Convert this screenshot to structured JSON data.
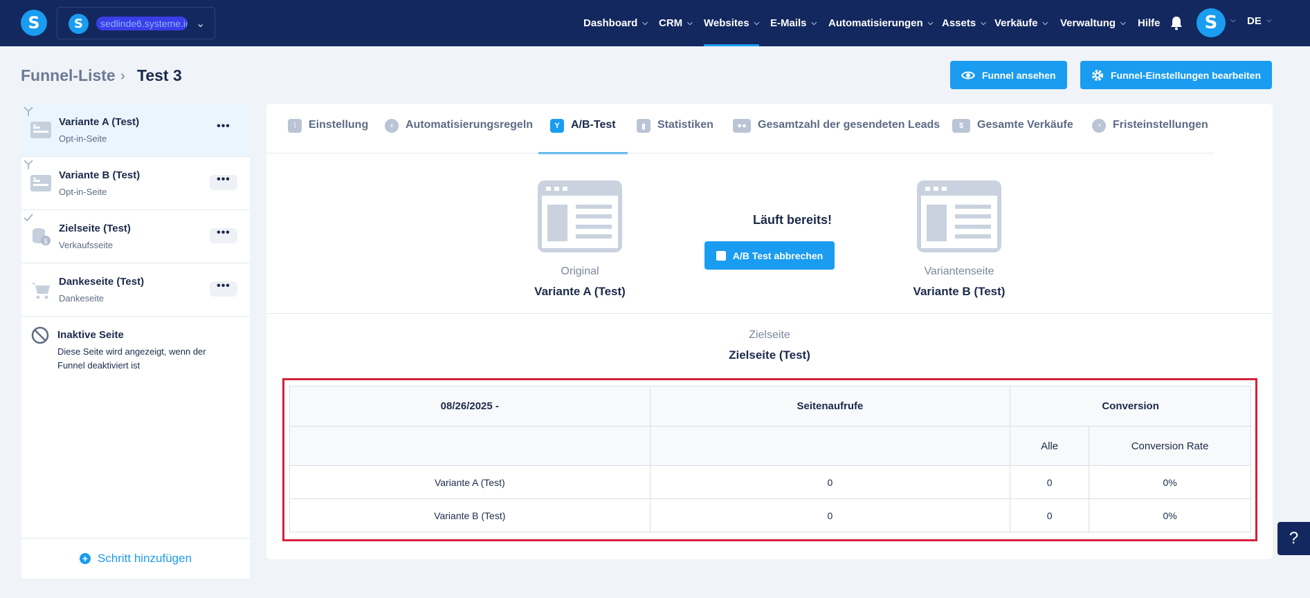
{
  "workspace": {
    "logo_letter": "S",
    "name": "sedlinde6.systeme.io"
  },
  "nav": {
    "items": [
      {
        "label": "Dashboard",
        "caret": true
      },
      {
        "label": "CRM",
        "caret": true
      },
      {
        "label": "Websites",
        "caret": true,
        "active": true
      },
      {
        "label": "E-Mails",
        "caret": true
      },
      {
        "label": "Automatisierungen",
        "caret": true
      },
      {
        "label": "Assets",
        "caret": true
      },
      {
        "label": "Verkäufe",
        "caret": true
      },
      {
        "label": "Verwaltung",
        "caret": true
      },
      {
        "label": "Hilfe",
        "caret": false
      }
    ],
    "user_letter": "S",
    "language": "DE"
  },
  "breadcrumb": {
    "parent": "Funnel-Liste",
    "current": "Test 3"
  },
  "actions": {
    "view_funnel": "Funnel ansehen",
    "edit_settings": "Funnel-Einstellungen bearbeiten"
  },
  "sidebar": {
    "steps": [
      {
        "title": "Variante A (Test)",
        "subtitle": "Opt-in-Seite",
        "icon": "opt-in-page-icon",
        "active": true
      },
      {
        "title": "Variante B (Test)",
        "subtitle": "Opt-in-Seite",
        "icon": "opt-in-page-icon"
      },
      {
        "title": "Zielseite (Test)",
        "subtitle": "Verkaufsseite",
        "icon": "sales-page-icon"
      },
      {
        "title": "Dankeseite (Test)",
        "subtitle": "Dankeseite",
        "icon": "thank-you-cart-icon"
      }
    ],
    "more_label": "•••",
    "inactive": {
      "title": "Inaktive Seite",
      "description": "Diese Seite wird angezeigt, wenn der Funnel deaktiviert ist"
    },
    "add_step": "Schritt hinzufügen"
  },
  "tabs": [
    {
      "label": "Einstellung",
      "icon": "settings-sliders-icon"
    },
    {
      "label": "Automatisierungsregeln",
      "icon": "lightning-icon"
    },
    {
      "label": "A/B-Test",
      "icon": "split-icon",
      "active": true
    },
    {
      "label": "Statistiken",
      "icon": "bar-chart-icon"
    },
    {
      "label": "Gesamtzahl der gesendeten Leads",
      "icon": "users-icon"
    },
    {
      "label": "Gesamte Verkäufe",
      "icon": "dollar-icon"
    },
    {
      "label": "Fristeinstellungen",
      "icon": "clock-icon"
    }
  ],
  "ab_test": {
    "original_label": "Original",
    "original_name": "Variante A (Test)",
    "status": "Läuft bereits!",
    "cancel_button": "A/B Test abbrechen",
    "variant_label": "Variantenseite",
    "variant_name": "Variante B (Test)",
    "goal_label": "Zielseite",
    "goal_name": "Zielseite (Test)"
  },
  "stats_table": {
    "date_header": "08/26/2025 -",
    "views_header": "Seitenaufrufe",
    "conversion_header": "Conversion",
    "sub_all": "Alle",
    "sub_rate": "Conversion Rate",
    "rows": [
      {
        "name": "Variante A (Test)",
        "views": "0",
        "all": "0",
        "rate": "0%"
      },
      {
        "name": "Variante B (Test)",
        "views": "0",
        "all": "0",
        "rate": "0%"
      }
    ]
  },
  "help_label": "?",
  "colors": {
    "nav_bg": "#13285e",
    "accent": "#1a9cf0",
    "highlight": "#d61f3a"
  }
}
